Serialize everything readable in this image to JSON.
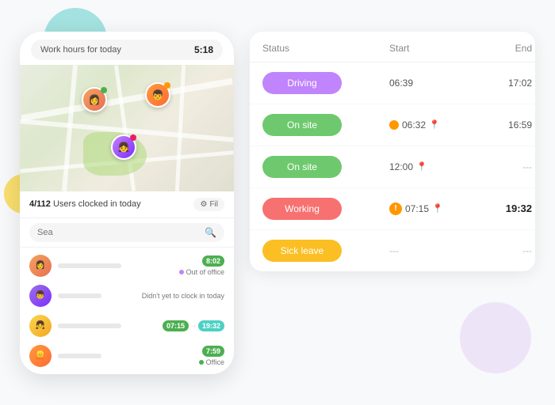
{
  "decorative": {
    "bg_circle_teal": "teal",
    "bg_circle_yellow": "yellow",
    "bg_circle_purple": "purple"
  },
  "phone": {
    "work_hours_label": "Work hours for today",
    "work_hours_value": "5:18",
    "clocked_count": "4/112",
    "clocked_label": "Users clocked in today",
    "filter_label": "Fil",
    "search_placeholder": "Sea",
    "users": [
      {
        "id": 1,
        "avatar_class": "uav1",
        "avatar_initials": "",
        "time_badge": "8:02",
        "badge_class": "badge-green",
        "status_text": "Out of office",
        "status_dot_color": "#c084fc",
        "show_time_range": false,
        "show_not_clocked": false
      },
      {
        "id": 2,
        "avatar_class": "uav2",
        "avatar_initials": "",
        "time_badge": "",
        "status_text": "Didn't yet to clock in today",
        "show_time_range": false,
        "show_not_clocked": true
      },
      {
        "id": 3,
        "avatar_class": "uav3",
        "avatar_initials": "",
        "time_start": "07:15",
        "time_end": "19:32",
        "show_time_range": true,
        "show_not_clocked": false
      },
      {
        "id": 4,
        "avatar_class": "uav4",
        "avatar_initials": "",
        "time_badge": "7:59",
        "badge_class": "badge-green",
        "status_text": "Office",
        "status_dot_color": "#4caf50",
        "show_time_range": false,
        "show_not_clocked": false
      }
    ]
  },
  "table": {
    "headers": [
      "Status",
      "Start",
      "End"
    ],
    "rows": [
      {
        "status_label": "Driving",
        "status_badge_class": "badge-purple",
        "start_time": "06:39",
        "has_orange_dot": false,
        "has_location": false,
        "has_exclamation": false,
        "end_time": "17:02",
        "end_bold": false,
        "end_dash": false
      },
      {
        "status_label": "On site",
        "status_badge_class": "badge-green-on",
        "start_time": "06:32",
        "has_orange_dot": true,
        "has_location": true,
        "has_exclamation": false,
        "end_time": "16:59",
        "end_bold": false,
        "end_dash": false
      },
      {
        "status_label": "On site",
        "status_badge_class": "badge-green-on",
        "start_time": "12:00",
        "has_orange_dot": false,
        "has_location": true,
        "has_exclamation": false,
        "end_time": "---",
        "end_bold": false,
        "end_dash": true
      },
      {
        "status_label": "Working",
        "status_badge_class": "badge-pink",
        "start_time": "07:15",
        "has_orange_dot": false,
        "has_location": true,
        "has_exclamation": true,
        "end_time": "19:32",
        "end_bold": true,
        "end_dash": false
      },
      {
        "status_label": "Sick leave",
        "status_badge_class": "badge-yellow",
        "start_time": "---",
        "has_orange_dot": false,
        "has_location": false,
        "has_exclamation": false,
        "end_time": "---",
        "end_bold": false,
        "end_dash": true
      }
    ]
  }
}
